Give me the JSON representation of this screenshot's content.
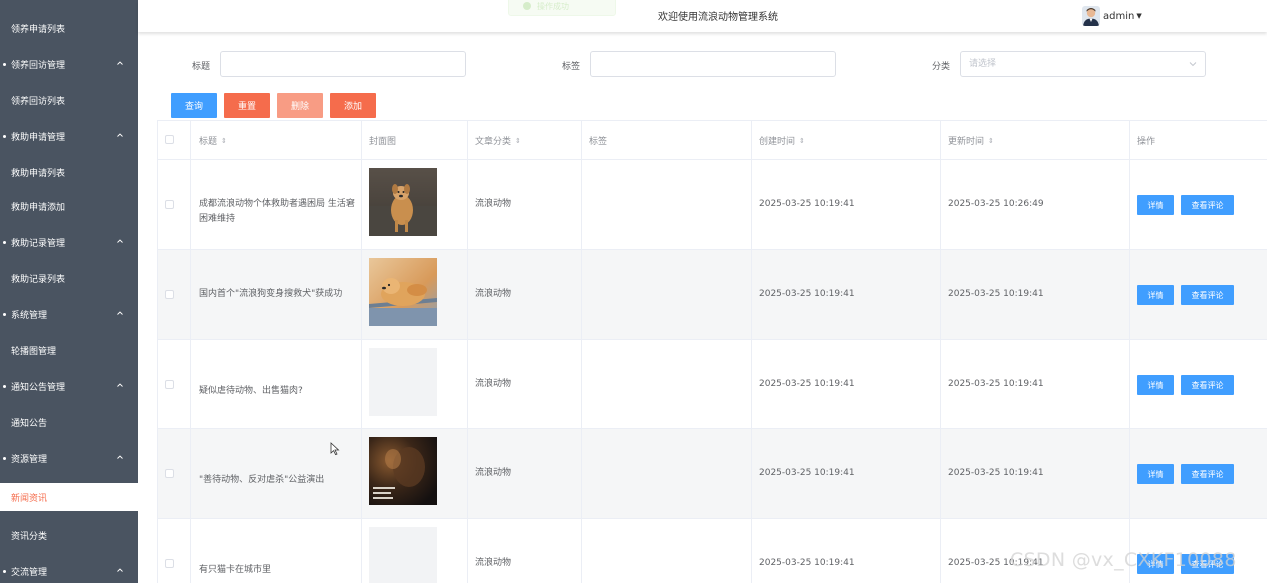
{
  "header": {
    "toast_text": "操作成功",
    "site_title": "欢迎使用流浪动物管理系统",
    "username": "admin"
  },
  "sidebar": {
    "items": [
      {
        "label": "领养申请列表",
        "kind": "child",
        "active": false
      },
      {
        "label": "领养回访管理",
        "kind": "group",
        "active": false
      },
      {
        "label": "领养回访列表",
        "kind": "child",
        "active": false
      },
      {
        "label": "救助申请管理",
        "kind": "group",
        "active": false
      },
      {
        "label": "救助申请列表",
        "kind": "child",
        "active": false
      },
      {
        "label": "救助申请添加",
        "kind": "child",
        "active": false
      },
      {
        "label": "救助记录管理",
        "kind": "group",
        "active": false
      },
      {
        "label": "救助记录列表",
        "kind": "child",
        "active": false
      },
      {
        "label": "系统管理",
        "kind": "group",
        "active": false
      },
      {
        "label": "轮播图管理",
        "kind": "child",
        "active": false
      },
      {
        "label": "通知公告管理",
        "kind": "group",
        "active": false
      },
      {
        "label": "通知公告",
        "kind": "child",
        "active": false
      },
      {
        "label": "资源管理",
        "kind": "group",
        "active": false
      },
      {
        "label": "新闻资讯",
        "kind": "child",
        "active": true
      },
      {
        "label": "资讯分类",
        "kind": "child",
        "active": false
      },
      {
        "label": "交流管理",
        "kind": "group",
        "active": false
      }
    ]
  },
  "search": {
    "title_label": "标题",
    "tag_label": "标签",
    "category_label": "分类",
    "category_placeholder": "请选择"
  },
  "actions": {
    "query": "查询",
    "reset": "重置",
    "delete": "删除",
    "add": "添加"
  },
  "table": {
    "headers": {
      "title": "标题",
      "cover": "封面图",
      "category": "文章分类",
      "tags": "标签",
      "created": "创建时间",
      "updated": "更新时间",
      "ops": "操作"
    },
    "detail_label": "详情",
    "comments_label": "查看评论",
    "rows": [
      {
        "title": "成都流浪动物个体救助者遇困局 生活窘困难维持",
        "cover": "dog-grass",
        "category": "流浪动物",
        "tags": "",
        "created": "2025-03-25 10:19:41",
        "updated": "2025-03-25 10:26:49"
      },
      {
        "title": "国内首个\"流浪狗变身搜救犬\"获成功",
        "cover": "dog-sunset",
        "category": "流浪动物",
        "tags": "",
        "created": "2025-03-25 10:19:41",
        "updated": "2025-03-25 10:19:41"
      },
      {
        "title": "疑似虐待动物、出售猫肉?",
        "cover": "none",
        "category": "流浪动物",
        "tags": "",
        "created": "2025-03-25 10:19:41",
        "updated": "2025-03-25 10:19:41"
      },
      {
        "title": "\"善待动物、反对虐杀\"公益演出",
        "cover": "cat-dark",
        "category": "流浪动物",
        "tags": "",
        "created": "2025-03-25 10:19:41",
        "updated": "2025-03-25 10:19:41"
      },
      {
        "title": "有只猫卡在城市里",
        "cover": "none",
        "category": "流浪动物",
        "tags": "",
        "created": "2025-03-25 10:19:41",
        "updated": "2025-03-25 10:19:41"
      }
    ]
  },
  "watermark": "CSDN @vx_CXKF10088",
  "colors": {
    "sidebar_bg": "#4a5461",
    "primary": "#409eff",
    "danger": "#f56c4c",
    "danger_light": "#f89c84",
    "active_text": "#f56c4c"
  }
}
